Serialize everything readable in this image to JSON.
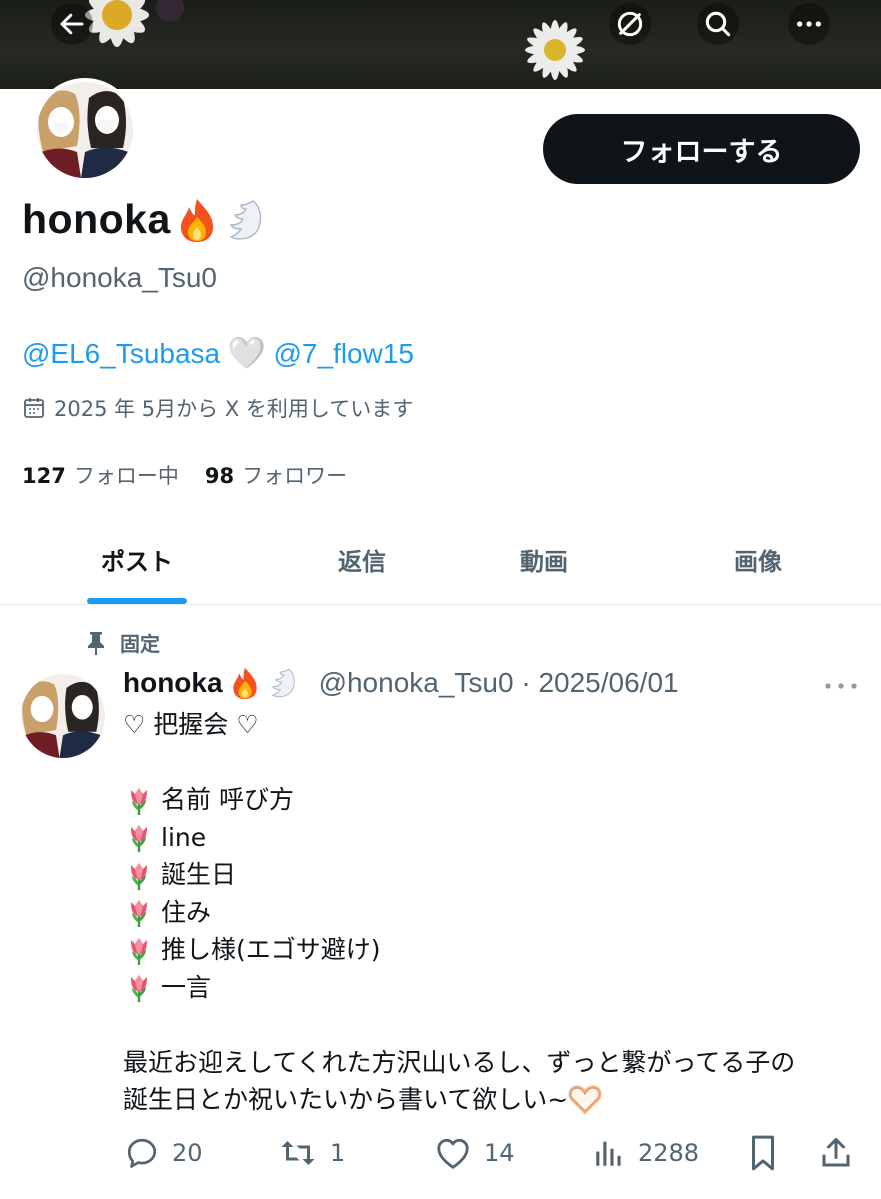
{
  "header": {
    "back_icon": "arrow-left-icon",
    "hide_icon": "eye-slash-icon",
    "search_icon": "search-icon",
    "more_icon": "more-horizontal-icon"
  },
  "profile": {
    "display_name": "honoka",
    "name_emojis": [
      "fire-emoji",
      "wing-emoji"
    ],
    "handle": "@honoka_Tsu0",
    "follow_label": "フォローする",
    "bio": {
      "mention_1": "@EL6_Tsubasa",
      "heart": "🤍",
      "mention_2": "@7_flow15"
    },
    "joined": "2025 年 5月から X を利用しています",
    "following_count": "127",
    "following_label": "フォロー中",
    "followers_count": "98",
    "followers_label": "フォロワー"
  },
  "tabs": [
    {
      "label": "ポスト",
      "active": true
    },
    {
      "label": "返信",
      "active": false
    },
    {
      "label": "動画",
      "active": false
    },
    {
      "label": "画像",
      "active": false
    }
  ],
  "post": {
    "pinned_label": "固定",
    "author_name": "honoka",
    "meta": "@honoka_Tsu0 · 2025/06/01",
    "lines": [
      "♡ 把握会 ♡",
      "",
      "名前 呼び方",
      "line",
      "誕生日",
      "住み",
      "推し様(エゴサ避け)",
      "一言",
      "",
      "最近お迎えしてくれた方沢山いるし、ずっと繋がってる子の",
      "誕生日とか祝いたいから書いて欲しい~"
    ],
    "tulip_lines": [
      2,
      3,
      4,
      5,
      6,
      7
    ],
    "replies": "20",
    "reposts": "1",
    "likes": "14",
    "views": "2288"
  },
  "colors": {
    "accent": "#1d9bf0",
    "text": "#0f1419",
    "secondary": "#536471",
    "button_bg": "#0f1419"
  }
}
